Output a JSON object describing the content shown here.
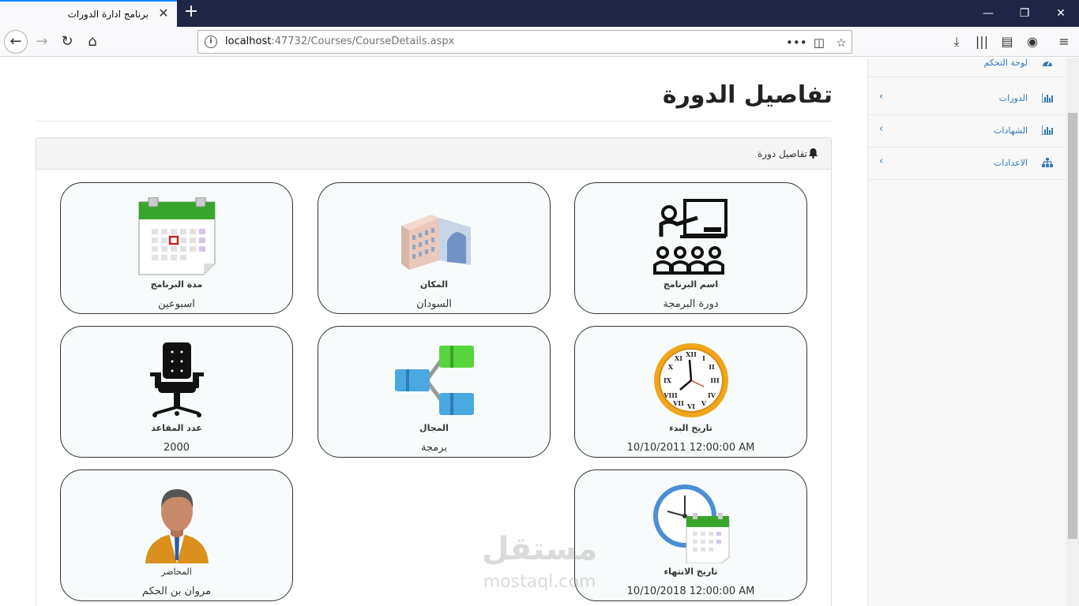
{
  "browser": {
    "tab_title": "برنامج ادارة الدورات",
    "url_host": "localhost",
    "url_rest": ":47732/Courses/CourseDetails.aspx"
  },
  "page": {
    "title": "تفاصيل الدورة",
    "panel_heading": "تفاصيل دورة"
  },
  "cards": {
    "program_name": {
      "label": "اسم البرنامج",
      "value": "دورة البرمجة",
      "icon": "teacher-class-icon"
    },
    "location": {
      "label": "المكان",
      "value": "السودان",
      "icon": "building-icon"
    },
    "duration": {
      "label": "مدة البرنامج",
      "value": "اسبوعين",
      "icon": "calendar-icon"
    },
    "start_date": {
      "label": "تاريخ البدء",
      "value": "10/10/2011 12:00:00 AM",
      "icon": "clock-icon"
    },
    "field": {
      "label": "المجال",
      "value": "برمجة",
      "icon": "hierarchy-icon"
    },
    "seats": {
      "label": "عدد المقاعد",
      "value": "2000",
      "icon": "chair-icon"
    },
    "end_date": {
      "label": "تاريخ الانتهاء",
      "value": "10/10/2018 12:00:00 AM",
      "icon": "clock-calendar-icon"
    },
    "instructor": {
      "label": "المحاضر",
      "value": "مروان بن الحكم",
      "icon": "person-icon"
    }
  },
  "sidebar": {
    "items": [
      {
        "label": "لوحة التحكم",
        "icon": "dashboard-icon"
      },
      {
        "label": "الدورات",
        "icon": "bar-chart-icon"
      },
      {
        "label": "الشهادات",
        "icon": "bar-chart-icon"
      },
      {
        "label": "الاعدادات",
        "icon": "sitemap-icon"
      }
    ]
  },
  "watermark": {
    "arabic": "مستقل",
    "latin": "mostaql.com"
  },
  "colors": {
    "accent": "#337ab7",
    "titlebar": "#1f2545",
    "card_bg": "#f7fbfb"
  }
}
